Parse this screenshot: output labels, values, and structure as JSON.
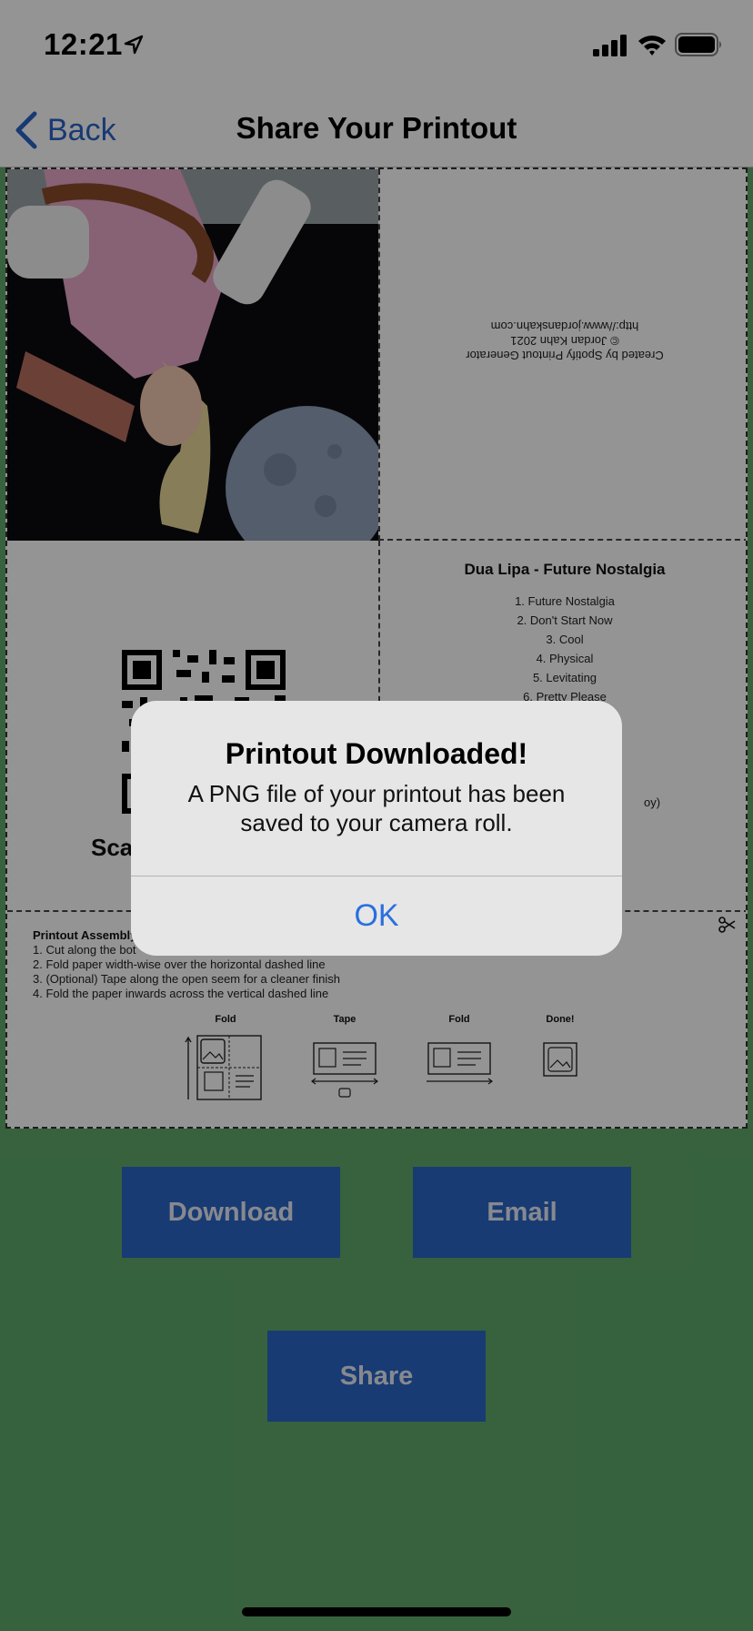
{
  "status_bar": {
    "time": "12:21"
  },
  "nav": {
    "back_label": "Back",
    "title": "Share Your Printout"
  },
  "printout": {
    "credits": [
      "Created by Spotify Printout Generator",
      "© Jordan Kahn 2021",
      "http://www.jordanskahn.com"
    ],
    "scan_text": "Sca",
    "album_title": "Dua Lipa - Future Nostalgia",
    "tracks": [
      "1. Future Nostalgia",
      "2. Don't Start Now",
      "3. Cool",
      "4. Physical",
      "5. Levitating",
      "6. Pretty Please"
    ],
    "track_partial": "oy)",
    "assembly_title": "Printout Assembly",
    "assembly_steps": [
      "1. Cut along the bot",
      "2. Fold paper width-wise over the horizontal dashed line",
      "3. (Optional) Tape along the open seem for a cleaner finish",
      "4. Fold the paper inwards across the vertical dashed line"
    ],
    "diagram_labels": [
      "Fold",
      "Tape",
      "Fold",
      "Done!"
    ]
  },
  "buttons": {
    "download": "Download",
    "email": "Email",
    "share": "Share"
  },
  "alert": {
    "title": "Printout Downloaded!",
    "message": "A PNG file of your printout has been saved to your camera roll.",
    "ok": "OK"
  },
  "colors": {
    "accent": "#2a67c8",
    "background": "#5fa96a",
    "link": "#2a6fe0"
  },
  "icons": [
    "location-arrow-icon",
    "signal-icon",
    "wifi-icon",
    "battery-icon",
    "back-chevron-icon",
    "qr-code-icon",
    "scissors-icon"
  ]
}
